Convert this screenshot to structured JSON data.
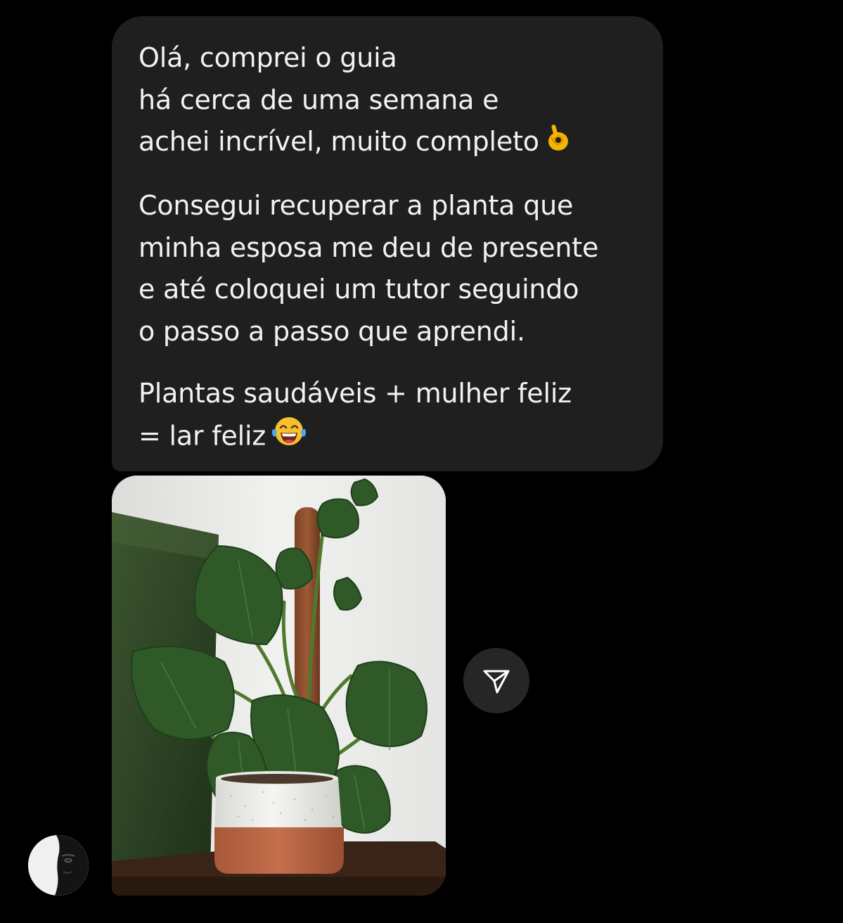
{
  "message": {
    "paragraphs": [
      {
        "text": "Olá, comprei o guia\nhá cerca de uma semana e\nachei incrível, muito completo",
        "emoji": "ok-hand"
      },
      {
        "text": "Consegui recuperar a planta que\nminha esposa me deu de presente\ne até coloquei um tutor seguindo\no passo a passo que aprendi.",
        "emoji": ""
      },
      {
        "text": "Plantas saudáveis + mulher feliz\n= lar feliz",
        "emoji": "tears-of-joy"
      }
    ]
  },
  "attachment": {
    "image": "houseplant-with-moss-pole-photo"
  },
  "actions": {
    "share_icon": "paper-plane-icon"
  },
  "colors": {
    "background": "#000000",
    "bubble": "#1f1f1f",
    "text": "#f2f2f2",
    "share_button": "#262626"
  }
}
